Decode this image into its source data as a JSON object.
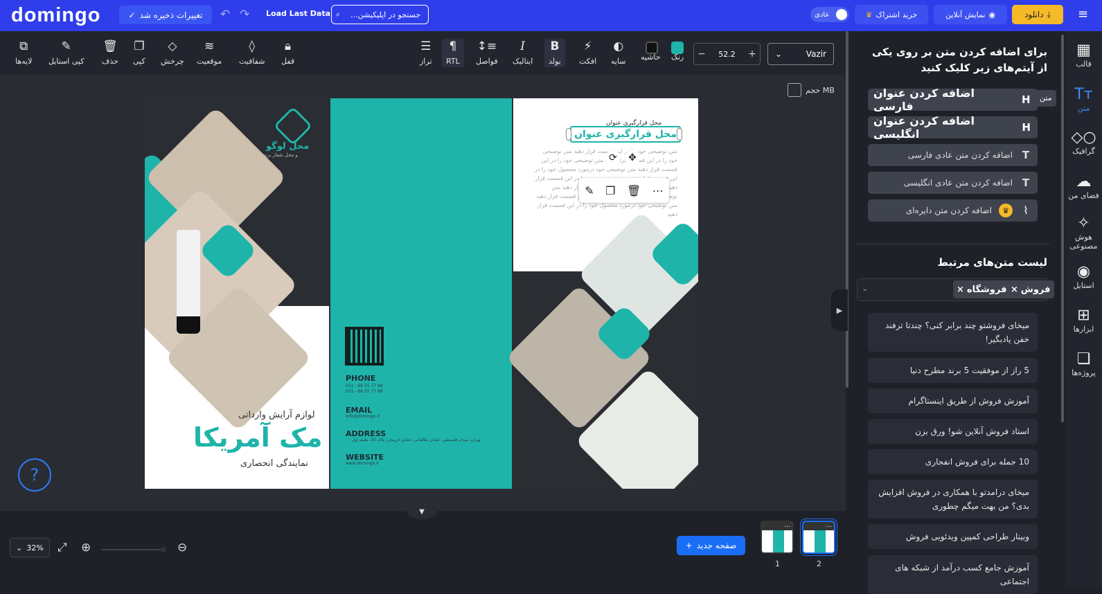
{
  "topbar": {
    "logo": "domingo",
    "save_label": "تغییرات ذخیره شد",
    "load_last": "Load Last Data",
    "search_placeholder": "جستجو در اپلیکیشن...",
    "mode_label": "عادی",
    "subscribe_label": "خرید اشتراک",
    "live_label": "نمایش آنلاین",
    "download_label": "دانلود"
  },
  "toolbar": {
    "layers": "لایه‌ها",
    "copy_style": "کپی استایل",
    "delete": "حذف",
    "copy": "کپی",
    "rotate": "چرخش",
    "position": "موقعیت",
    "opacity": "شفافیت",
    "lock": "قفل",
    "align": "تراز",
    "rtl": "RTL",
    "spacing": "فواصل",
    "italic": "ایتالیک",
    "bold": "بولد",
    "effect": "افکت",
    "shadow": "سایه",
    "border": "حاشیه",
    "color": "رنگ",
    "font_size": "52.2",
    "font_family": "Vazir",
    "color_value": "#1fb4aa",
    "border_color": "#111111"
  },
  "canvas": {
    "volume_label": "حجم MB",
    "logo_text": "محل لوگو",
    "logo_sub": "و محل شعار برند",
    "brand_sub": "لوازم آرایش وارداتی",
    "brand_name": "مک آمریکا",
    "brand_rep": "نمایندگی انحصاری",
    "phone_label": "PHONE",
    "phone_1": "021 - 66 55 77 88",
    "phone_2": "021 - 66 55 77 88",
    "email_label": "EMAIL",
    "email_value": "info@domingo.ir",
    "address_label": "ADDRESS",
    "address_value": "تهران، میدان فلسطین، خیابان طالقانی، خیابان فریمان، پلاک 30، طبقه اول",
    "website_label": "WEBSITE",
    "website_value": "www.domingo.ir",
    "small_title": "محل قرارگیری عنوان",
    "selected_title": "محل قرارگیری عنوان",
    "placeholder_text": "متن توضیحی خود را در این قسمت قرار دهید متن توضیحی خود را در این قسمت قرار دهید متن توضیحی خود را در این قسمت قرار دهید متن توضیحی خود درمورد محصول خود را در این قسمت قرار دهید متن توضیحی خود را در این قسمت قرار دهید متن توضیحی خود را در این قسمت قرار دهید متن توضیحی خود درمورد محصول خود را در این قسمت قرار دهید متن توضیحی خود درمورد محصول خود را در این قسمت قرار دهید",
    "accent": "#1fb4aa",
    "dark": "#2a2d31"
  },
  "bottom": {
    "zoom": "32%",
    "new_page": "صفحه جدید",
    "page1": "1",
    "page2": "2",
    "thumb_menu": "..."
  },
  "sidepanel": {
    "heading": "برای اضافه کردن متن بر روی یکی از آیتم‌های زیر کلیک کنید",
    "tooltip": "متن",
    "items": [
      {
        "label": "اضافه کردن عنوان فارسی",
        "icon": "H"
      },
      {
        "label": "اضافه کردن عنوان انگلیسی",
        "icon": "H"
      },
      {
        "label": "اضافه کردن متن عادی فارسی",
        "icon": "T"
      },
      {
        "label": "اضافه کردن متن عادی انگلیسی",
        "icon": "T"
      },
      {
        "label": "اضافه کردن متن دایره‌ای",
        "icon": "curve-text-icon"
      }
    ],
    "related_heading": "لیست متن‌های مرتبط",
    "tags": [
      "فروش",
      "فروشگاه"
    ],
    "related": [
      "میخای فروشتو چند برابر کنی؟ چندتا ترفند خفن یادبگیر!",
      "5 راز از موفقیت 5 برند مطرح دنیا",
      "آموزش فروش از طریق اینستاگرام",
      "استاد فروش آنلاین شو! ورق بزن",
      "10 جمله برای فروش انفجاری",
      "میخای درامدتو با همکاری در فروش افزایش بدی؟ من بهت میگم چطوری",
      "وبینار طراحی کمپین ویدئویی فروش",
      "آموزش جامع کسب درآمد از شبکه های اجتماعی"
    ]
  },
  "rail": {
    "template": "قالب",
    "text": "متن",
    "graphic": "گرافیک",
    "myspace": "فضای من",
    "ai": "هوش مصنوعی",
    "style": "استایل",
    "tools": "ابزارها",
    "projects": "پروژه‌ها"
  }
}
